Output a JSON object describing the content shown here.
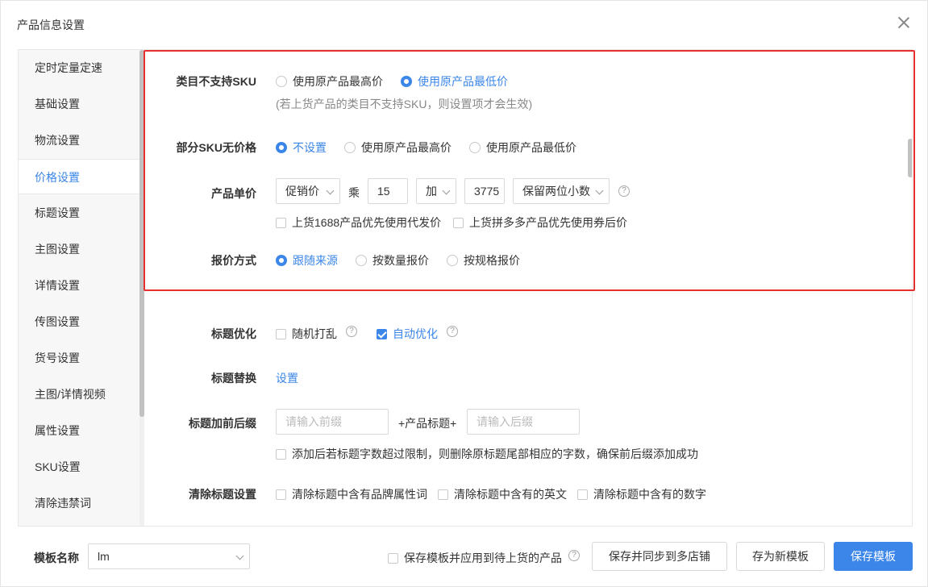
{
  "dialog": {
    "title": "产品信息设置"
  },
  "sidebar": {
    "items": [
      {
        "label": "定时定量定速"
      },
      {
        "label": "基础设置"
      },
      {
        "label": "物流设置"
      },
      {
        "label": "价格设置",
        "active": true
      },
      {
        "label": "标题设置"
      },
      {
        "label": "主图设置"
      },
      {
        "label": "详情设置"
      },
      {
        "label": "传图设置"
      },
      {
        "label": "货号设置"
      },
      {
        "label": "主图/详情视频"
      },
      {
        "label": "属性设置"
      },
      {
        "label": "SKU设置"
      },
      {
        "label": "清除违禁词"
      }
    ]
  },
  "price": {
    "category_sku": {
      "label": "类目不支持SKU",
      "options": [
        "使用原产品最高价",
        "使用原产品最低价"
      ],
      "selected": "使用原产品最低价",
      "hint": "(若上货产品的类目不支持SKU，则设置项才会生效)"
    },
    "partial_sku": {
      "label": "部分SKU无价格",
      "options": [
        "不设置",
        "使用原产品最高价",
        "使用原产品最低价"
      ],
      "selected": "不设置"
    },
    "unit_price": {
      "label": "产品单价",
      "base_select": "促销价",
      "multiply_text": "乘",
      "multiplier": "15",
      "op_select": "加",
      "add_value": "3775",
      "round_select": "保留两位小数",
      "check_1688": "上货1688产品优先使用代发价",
      "check_pdd": "上货拼多多产品优先使用券后价"
    },
    "quote": {
      "label": "报价方式",
      "options": [
        "跟随来源",
        "按数量报价",
        "按规格报价"
      ],
      "selected": "跟随来源"
    }
  },
  "title": {
    "optimize": {
      "label": "标题优化",
      "random": "随机打乱",
      "auto": "自动优化"
    },
    "replace": {
      "label": "标题替换",
      "link": "设置"
    },
    "prefix_suffix": {
      "label": "标题加前后缀",
      "prefix_placeholder": "请输入前缀",
      "middle": "+产品标题+",
      "suffix_placeholder": "请输入后缀",
      "overflow_check": "添加后若标题字数超过限制，则删除原标题尾部相应的字数，确保前后缀添加成功"
    },
    "clear": {
      "label": "清除标题设置",
      "brand": "清除标题中含有品牌属性词",
      "english": "清除标题中含有的英文",
      "digits": "清除标题中含有的数字"
    }
  },
  "footer": {
    "template_label": "模板名称",
    "template_value": "lm",
    "apply_check": "保存模板并应用到待上货的产品",
    "sync_button": "保存并同步到多店铺",
    "new_button": "存为新模板",
    "save_button": "保存模板"
  },
  "colors": {
    "accent": "#3b86e8",
    "highlight_border": "#e53030"
  }
}
